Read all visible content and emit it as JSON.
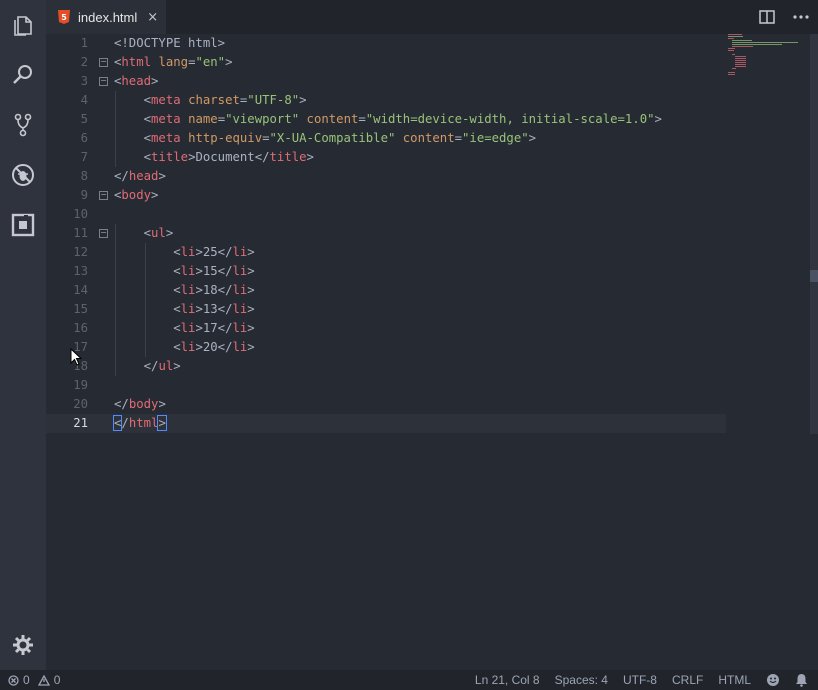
{
  "tab": {
    "label": "index.html",
    "close": "×"
  },
  "code_lines": [
    "<!DOCTYPE html>",
    "<html lang=\"en\">",
    "<head>",
    "    <meta charset=\"UTF-8\">",
    "    <meta name=\"viewport\" content=\"width=device-width, initial-scale=1.0\">",
    "    <meta http-equiv=\"X-UA-Compatible\" content=\"ie=edge\">",
    "    <title>Document</title>",
    "</head>",
    "<body>",
    "",
    "    <ul>",
    "        <li>25</li>",
    "        <li>15</li>",
    "        <li>18</li>",
    "        <li>13</li>",
    "        <li>17</li>",
    "        <li>20</li>",
    "    </ul>",
    "",
    "</body>",
    "</html>"
  ],
  "line_numbers": [
    "1",
    "2",
    "3",
    "4",
    "5",
    "6",
    "7",
    "8",
    "9",
    "10",
    "11",
    "12",
    "13",
    "14",
    "15",
    "16",
    "17",
    "18",
    "19",
    "20",
    "21"
  ],
  "current_line": 21,
  "fold_lines": [
    2,
    3,
    9,
    11
  ],
  "status": {
    "errors": "0",
    "warnings": "0",
    "position": "Ln 21, Col 8",
    "spaces": "Spaces: 4",
    "encoding": "UTF-8",
    "eol": "CRLF",
    "language": "HTML"
  },
  "icons": {
    "activity": [
      "explorer-icon",
      "search-icon",
      "source-control-icon",
      "debug-icon",
      "extensions-icon",
      "settings-gear-icon"
    ],
    "tab_actions": [
      "split-editor-icon",
      "more-actions-icon"
    ],
    "status_right": [
      "feedback-smiley-icon",
      "notifications-bell-icon"
    ]
  },
  "colors": {
    "tag": "#e06c75",
    "attribute": "#d19a66",
    "string": "#98c379",
    "text": "#abb2bf",
    "editor_bg": "#262a33",
    "sidebar_bg": "#2f333d",
    "html5_badge": "#e44d26"
  }
}
